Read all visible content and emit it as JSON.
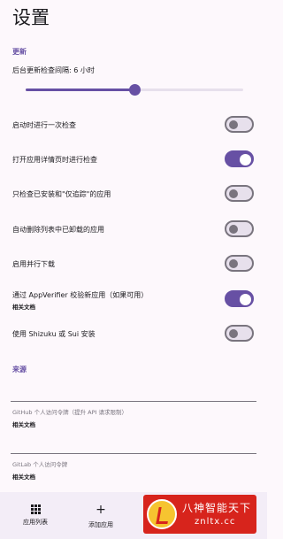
{
  "page": {
    "title": "设置"
  },
  "update_section": {
    "label": "更新",
    "interval_label": "后台更新检查间隔: 6 小时",
    "interval_fraction": 0.5
  },
  "toggles": [
    {
      "label": "启动时进行一次检查",
      "on": false
    },
    {
      "label": "打开应用详情页时进行检查",
      "on": true
    },
    {
      "label": "只检查已安装和\"仅追踪\"的应用",
      "on": false
    },
    {
      "label": "自动删除列表中已卸载的应用",
      "on": false
    },
    {
      "label": "启用并行下载",
      "on": false
    },
    {
      "label": "通过 AppVerifier 校验新应用（如果可用）",
      "sub": "相关文档",
      "on": true
    },
    {
      "label": "使用 Shizuku 或 Sui 安装",
      "on": false
    }
  ],
  "source_section": {
    "label": "来源",
    "fields": [
      {
        "label": "GitHub 个人访问令牌（提升 API 请求限制）",
        "doc": "相关文档"
      },
      {
        "label": "GitLab 个人访问令牌",
        "doc": "相关文档"
      }
    ]
  },
  "bottom_nav": {
    "items": [
      {
        "label": "应用列表",
        "icon": "grid-icon"
      },
      {
        "label": "添加应用",
        "icon": "plus-icon"
      }
    ]
  },
  "watermark": {
    "title": "八神智能天下",
    "url": "znltx.cc"
  },
  "colors": {
    "accent": "#6750a4",
    "background": "#fdf8fc",
    "switch_off": "#79747e"
  }
}
